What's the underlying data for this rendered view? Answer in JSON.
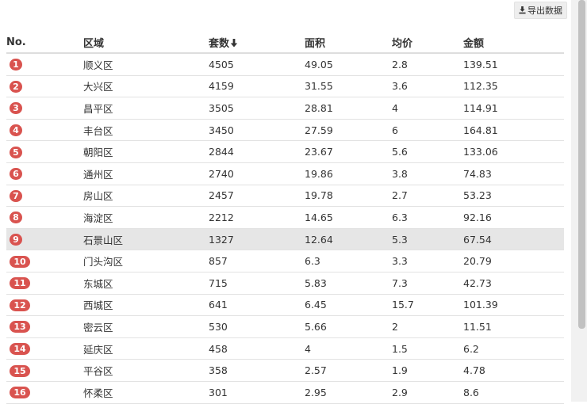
{
  "export_label": "导出数据",
  "columns": [
    "No.",
    "区域",
    "套数",
    "面积",
    "均价",
    "金额"
  ],
  "accent_color": "#d9534f",
  "highlight_row": 9,
  "rows": [
    {
      "no": "1",
      "district": "顺义区",
      "units": "4505",
      "area": "49.05",
      "avg_price": "2.8",
      "amount": "139.51"
    },
    {
      "no": "2",
      "district": "大兴区",
      "units": "4159",
      "area": "31.55",
      "avg_price": "3.6",
      "amount": "112.35"
    },
    {
      "no": "3",
      "district": "昌平区",
      "units": "3505",
      "area": "28.81",
      "avg_price": "4",
      "amount": "114.91"
    },
    {
      "no": "4",
      "district": "丰台区",
      "units": "3450",
      "area": "27.59",
      "avg_price": "6",
      "amount": "164.81"
    },
    {
      "no": "5",
      "district": "朝阳区",
      "units": "2844",
      "area": "23.67",
      "avg_price": "5.6",
      "amount": "133.06"
    },
    {
      "no": "6",
      "district": "通州区",
      "units": "2740",
      "area": "19.86",
      "avg_price": "3.8",
      "amount": "74.83"
    },
    {
      "no": "7",
      "district": "房山区",
      "units": "2457",
      "area": "19.78",
      "avg_price": "2.7",
      "amount": "53.23"
    },
    {
      "no": "8",
      "district": "海淀区",
      "units": "2212",
      "area": "14.65",
      "avg_price": "6.3",
      "amount": "92.16"
    },
    {
      "no": "9",
      "district": "石景山区",
      "units": "1327",
      "area": "12.64",
      "avg_price": "5.3",
      "amount": "67.54"
    },
    {
      "no": "10",
      "district": "门头沟区",
      "units": "857",
      "area": "6.3",
      "avg_price": "3.3",
      "amount": "20.79"
    },
    {
      "no": "11",
      "district": "东城区",
      "units": "715",
      "area": "5.83",
      "avg_price": "7.3",
      "amount": "42.73"
    },
    {
      "no": "12",
      "district": "西城区",
      "units": "641",
      "area": "6.45",
      "avg_price": "15.7",
      "amount": "101.39"
    },
    {
      "no": "13",
      "district": "密云区",
      "units": "530",
      "area": "5.66",
      "avg_price": "2",
      "amount": "11.51"
    },
    {
      "no": "14",
      "district": "延庆区",
      "units": "458",
      "area": "4",
      "avg_price": "1.5",
      "amount": "6.2"
    },
    {
      "no": "15",
      "district": "平谷区",
      "units": "358",
      "area": "2.57",
      "avg_price": "1.9",
      "amount": "4.78"
    },
    {
      "no": "16",
      "district": "怀柔区",
      "units": "301",
      "area": "2.95",
      "avg_price": "2.9",
      "amount": "8.6"
    }
  ]
}
